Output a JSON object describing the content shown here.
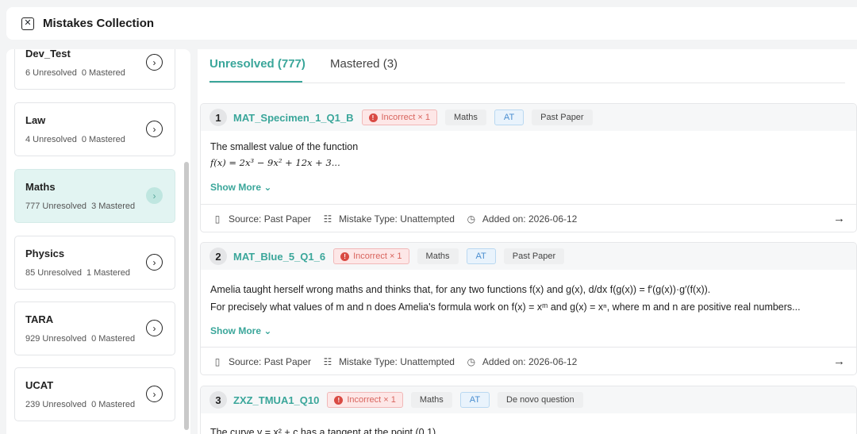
{
  "header": {
    "title": "Mistakes Collection",
    "close_icon": "close-icon"
  },
  "sidebar": {
    "subjects": [
      {
        "name": "Dev_Test",
        "unresolved": "6 Unresolved",
        "mastered": "0 Mastered"
      },
      {
        "name": "Law",
        "unresolved": "4 Unresolved",
        "mastered": "0 Mastered"
      },
      {
        "name": "Maths",
        "unresolved": "777 Unresolved",
        "mastered": "3 Mastered"
      },
      {
        "name": "Physics",
        "unresolved": "85 Unresolved",
        "mastered": "1 Mastered"
      },
      {
        "name": "TARA",
        "unresolved": "929 Unresolved",
        "mastered": "0 Mastered"
      },
      {
        "name": "UCAT",
        "unresolved": "239 Unresolved",
        "mastered": "0 Mastered"
      }
    ],
    "active_index": 2
  },
  "tabs": [
    {
      "label": "Unresolved (777)"
    },
    {
      "label": "Mastered (3)"
    }
  ],
  "questions": [
    {
      "num": "1",
      "id": "MAT_Specimen_1_Q1_B",
      "status": "Incorrect × 1",
      "tags": {
        "subject": "Maths",
        "type": "AT",
        "source_tag": "Past Paper"
      },
      "line1": "The smallest value of the function",
      "line2": "f(x) = 2x³ − 9x² + 12x + 3...",
      "show_more": "Show More",
      "source": "Source: Past Paper",
      "mistake_type": "Mistake Type: Unattempted",
      "added": "Added on: 2026-06-12"
    },
    {
      "num": "2",
      "id": "MAT_Blue_5_Q1_6",
      "status": "Incorrect × 1",
      "tags": {
        "subject": "Maths",
        "type": "AT",
        "source_tag": "Past Paper"
      },
      "line1": "Amelia taught herself wrong maths and thinks that, for any two functions f(x) and g(x), d/dx f(g(x)) = f′(g(x))·g′(f(x)).",
      "line2": "For precisely what values of m and n does Amelia's formula work on f(x) = xᵐ and g(x) = xⁿ, where m and n are positive real numbers...",
      "show_more": "Show More",
      "source": "Source: Past Paper",
      "mistake_type": "Mistake Type: Unattempted",
      "added": "Added on: 2026-06-12"
    },
    {
      "num": "3",
      "id": "ZXZ_TMUA1_Q10",
      "status": "Incorrect × 1",
      "tags": {
        "subject": "Maths",
        "type": "AT",
        "source_tag": "De novo question"
      },
      "line1": "The curve y = x² + c has a tangent at the point (0,1)"
    }
  ],
  "colors": {
    "accent": "#3aa69a",
    "error": "#d94a43",
    "info": "#4a8ed0"
  }
}
